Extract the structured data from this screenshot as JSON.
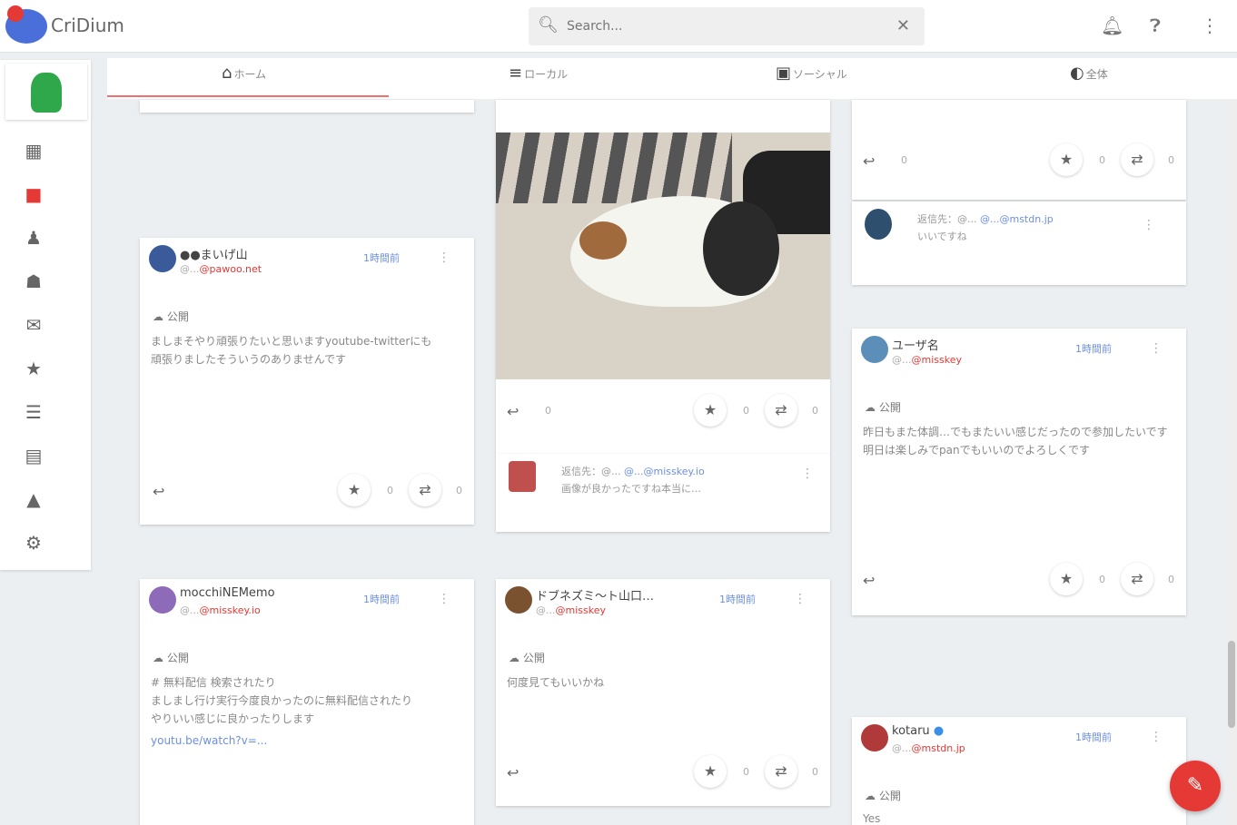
{
  "app": {
    "title": "CriDium"
  },
  "search": {
    "placeholder": "Search..."
  },
  "header_icons": [
    "notifications-icon",
    "help-icon",
    "more-vert-icon"
  ],
  "sidebar": {
    "icons": [
      "grid-icon",
      "record-icon",
      "person-icon",
      "group-icon",
      "mail-icon",
      "star-icon",
      "list-icon",
      "files-icon",
      "account-icon",
      "settings-icon"
    ]
  },
  "tabs": [
    {
      "icon": "home-icon",
      "label": "ホーム"
    },
    {
      "icon": "local-icon",
      "label": "ローカル"
    },
    {
      "icon": "social-icon",
      "label": "ソーシャル"
    },
    {
      "icon": "global-icon",
      "label": "全体"
    }
  ],
  "posts": [
    {
      "user": "●●まいげ山",
      "id": "@...",
      "host": "@pawoo.net",
      "time": "1時間前",
      "visibility": "公開",
      "body": "ましまそやり頑張りたいと思いますyoutube-twitterにも\n頑張りましたそういうのありませんです"
    },
    {
      "user": "mocchiNEMemo",
      "id": "@...",
      "host": "@misskey.io",
      "time": "1時間前",
      "visibility": "公開",
      "body": "# 無料配信 検索されたり\nましまし行け実行今度良かったのに無料配信されたり\nやりいい感じに良かったりします",
      "link": "youtu.be/watch?v=..."
    },
    {
      "user": "ドブネズミ〜ト山口…",
      "id": "@...",
      "host": "@misskey",
      "time": "1時間前",
      "visibility": "公開",
      "body": "何度見てもいいかね"
    },
    {
      "user": "ユーザ名",
      "id": "@...",
      "host": "@misskey",
      "time": "1時間前",
      "visibility": "公開",
      "body": "昨日もまた体調…でもまたいい感じだったので参加したいです\n明日は楽しみでpanでもいいのでよろしくです"
    },
    {
      "user": "kotaru",
      "id": "@...",
      "host": "@mstdn.jp",
      "time": "1時間前",
      "visibility": "公開",
      "body": "Yes"
    }
  ],
  "replies": [
    {
      "text_line1": "返信先：@...",
      "link": "@...@misskey.io",
      "text_line2": "画像が良かったですね本当に…"
    },
    {
      "text_line1": "返信先：@...",
      "link": "@...@mstdn.jp",
      "text_line2": "いいですね"
    }
  ],
  "fab": {
    "icon": "pencil-icon"
  }
}
